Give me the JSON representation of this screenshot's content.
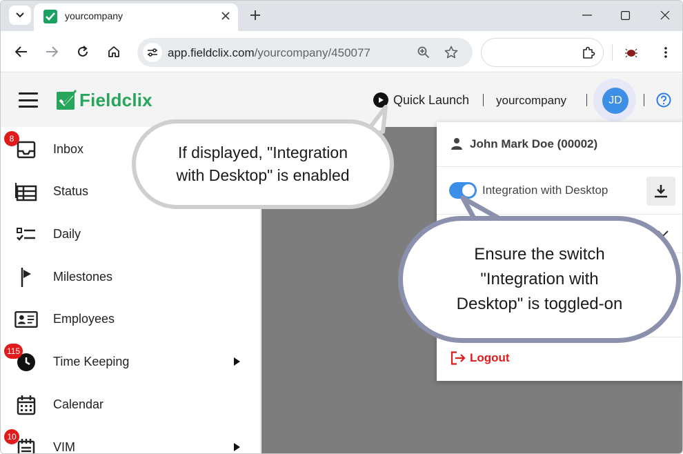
{
  "browser": {
    "tab_title": "yourcompany",
    "url_host": "app.fieldclix.com",
    "url_path": "/yourcompany/450077"
  },
  "header": {
    "brand": "Fieldclix",
    "quick_launch": "Quick Launch",
    "company": "yourcompany",
    "avatar_initials": "JD"
  },
  "sidebar": {
    "items": [
      {
        "label": "Inbox",
        "badge": "8",
        "icon": "inbox-icon"
      },
      {
        "label": "Status",
        "badge": "",
        "icon": "grid-icon"
      },
      {
        "label": "Daily",
        "badge": "",
        "icon": "checklist-icon"
      },
      {
        "label": "Milestones",
        "badge": "",
        "icon": "flag-icon"
      },
      {
        "label": "Employees",
        "badge": "",
        "icon": "id-card-icon"
      },
      {
        "label": "Time Keeping",
        "badge": "115",
        "icon": "clock-icon"
      },
      {
        "label": "Calendar",
        "badge": "",
        "icon": "calendar-icon"
      },
      {
        "label": "VIM",
        "badge": "10",
        "icon": "notepad-icon"
      }
    ]
  },
  "user_panel": {
    "user_name": "John Mark Doe (00002)",
    "integration_label": "Integration with Desktop",
    "integration_enabled": true,
    "logout_label": "Logout"
  },
  "callouts": {
    "top_line1": "If displayed, \"Integration",
    "top_line2": "with Desktop\" is enabled",
    "bottom_line1": "Ensure the switch",
    "bottom_line2": "\"Integration with",
    "bottom_line3": "Desktop\" is toggled-on"
  },
  "colors": {
    "brand_green": "#27a55a",
    "toggle_blue": "#3b8fe6",
    "badge_red": "#e01b1b",
    "avatar_blue": "#3d8ee6",
    "overlay_gray": "#7d7d7d"
  }
}
